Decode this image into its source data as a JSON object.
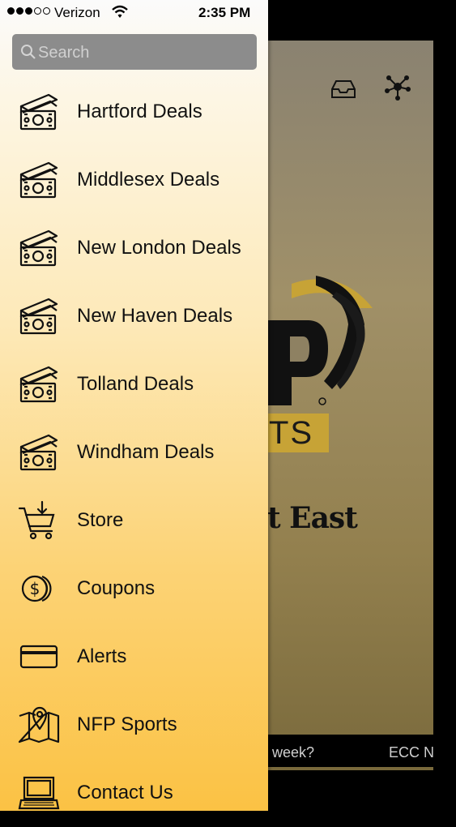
{
  "status_bar": {
    "carrier": "Verizon",
    "time": "2:35 PM"
  },
  "search": {
    "placeholder": "Search"
  },
  "menu": [
    {
      "label": "Hartford Deals",
      "icon": "money-stack-icon"
    },
    {
      "label": "Middlesex Deals",
      "icon": "money-stack-icon"
    },
    {
      "label": "New London Deals",
      "icon": "money-stack-icon"
    },
    {
      "label": "New Haven Deals",
      "icon": "money-stack-icon"
    },
    {
      "label": "Tolland Deals",
      "icon": "money-stack-icon"
    },
    {
      "label": "Windham Deals",
      "icon": "money-stack-icon"
    },
    {
      "label": "Store",
      "icon": "cart-icon"
    },
    {
      "label": "Coupons",
      "icon": "coupon-icon"
    },
    {
      "label": "Alerts",
      "icon": "card-icon"
    },
    {
      "label": "NFP Sports",
      "icon": "map-pin-icon"
    },
    {
      "label": "Contact Us",
      "icon": "laptop-icon"
    }
  ],
  "background_app": {
    "logo_text": "TS",
    "headline": "t East",
    "ticker": [
      "week?",
      "ECC N"
    ]
  },
  "colors": {
    "drawer_bottom": "#fbc244",
    "search_bg": "#8c8c8c",
    "logo_gold": "#c7a336"
  }
}
